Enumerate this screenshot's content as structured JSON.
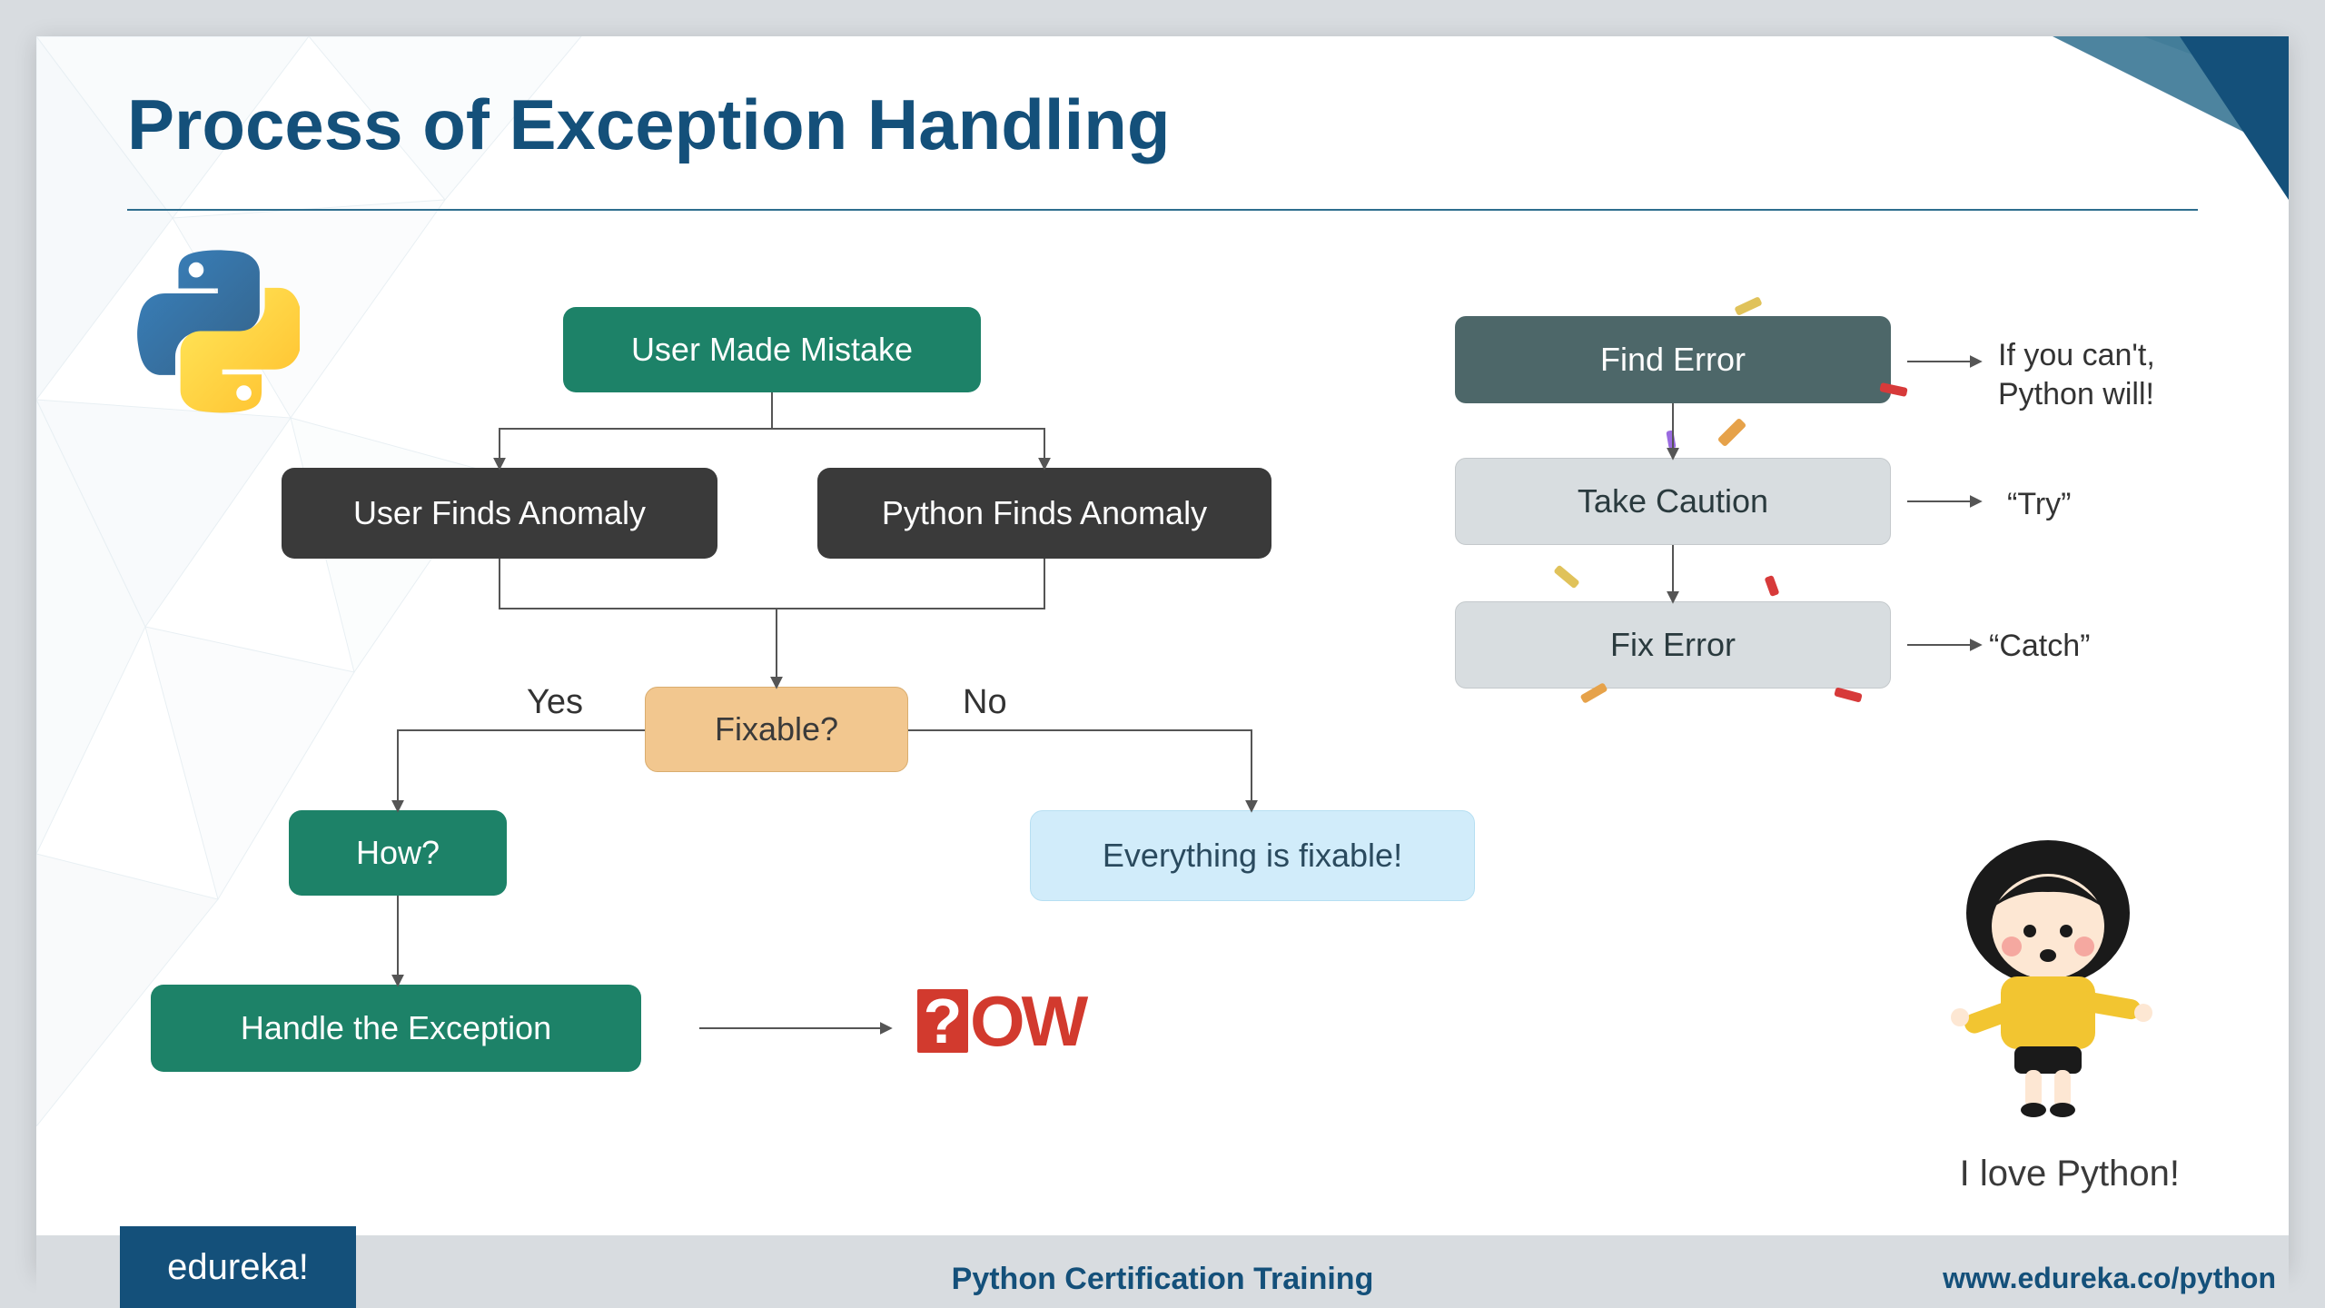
{
  "title": "Process of Exception Handling",
  "flowchart": {
    "user_made_mistake": "User Made Mistake",
    "user_finds_anomaly": "User Finds Anomaly",
    "python_finds_anomaly": "Python Finds Anomaly",
    "fixable": "Fixable?",
    "yes": "Yes",
    "no": "No",
    "how": "How?",
    "everything_fixable": "Everything is fixable!",
    "handle_exception": "Handle the Exception",
    "how_graphic_q": "?",
    "how_graphic_text": "OW"
  },
  "steps": {
    "find_error": {
      "label": "Find Error",
      "note": "If you can't,\nPython will!"
    },
    "take_caution": {
      "label": "Take Caution",
      "note": "“Try”"
    },
    "fix_error": {
      "label": "Fix Error",
      "note": "“Catch”"
    }
  },
  "character_caption": "I love Python!",
  "footer": {
    "brand": "edureka!",
    "center": "Python Certification Training",
    "link": "www.edureka.co/python"
  }
}
